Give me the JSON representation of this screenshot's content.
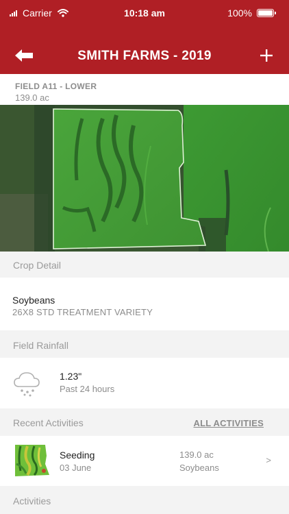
{
  "status_bar": {
    "carrier": "Carrier",
    "time": "10:18 am",
    "battery": "100%"
  },
  "nav": {
    "title": "SMITH FARMS - 2019",
    "back_icon": "back-arrow-icon",
    "add_icon": "plus-icon"
  },
  "field": {
    "name": "FIELD A11 - LOWER",
    "acres": "139.0 ac"
  },
  "crop_detail": {
    "header": "Crop Detail",
    "crop": "Soybeans",
    "variety": "26X8 STD TREATMENT VARIETY"
  },
  "rainfall": {
    "header": "Field Rainfall",
    "amount": "1.23\"",
    "period": "Past 24 hours",
    "icon": "rain-cloud-icon"
  },
  "recent_activities": {
    "header": "Recent Activities",
    "link": "ALL ACTIVITIES",
    "items": [
      {
        "name": "Seeding",
        "date": "03 June",
        "acres": "139.0 ac",
        "crop": "Soybeans",
        "chevron": ">"
      }
    ]
  },
  "activities": {
    "header": "Activities"
  },
  "colors": {
    "brand_red": "#b01f25",
    "section_bg": "#f3f3f3",
    "muted_text": "#8c8c8c"
  }
}
